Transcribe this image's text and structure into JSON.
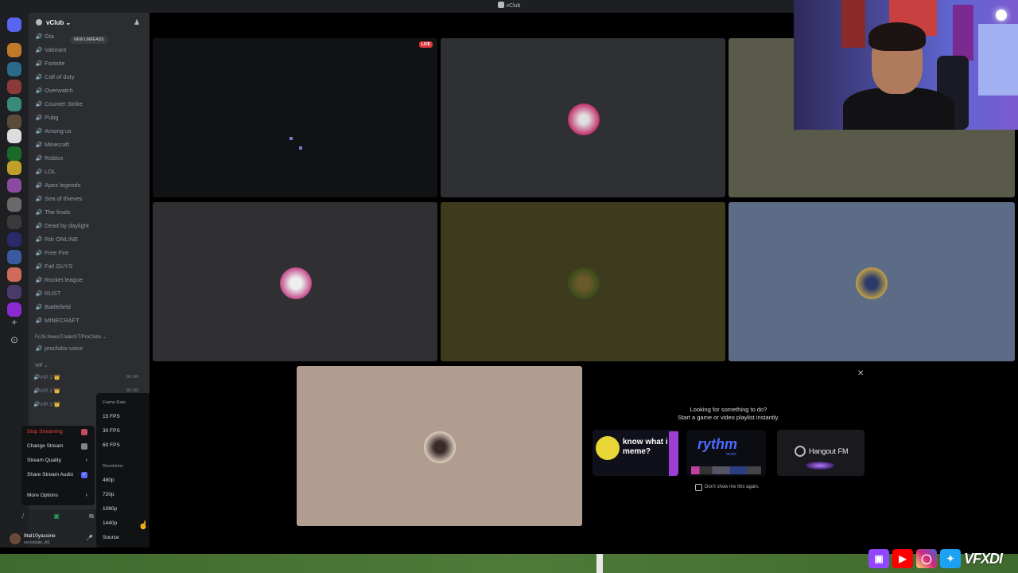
{
  "window": {
    "title": "vClub"
  },
  "server": {
    "name": "vClub ⌄",
    "new_unreads": "NEW UNREADS"
  },
  "channels": [
    "Gta",
    "Valorant",
    "Fortnite",
    "Call of duty",
    "Overwatch",
    "Counter Strike",
    "Pubg",
    "Among us",
    "Minecraft",
    "Roblox",
    "LOL",
    "Apex legends",
    "Sea of thieves",
    "The finals",
    "Dead by daylight",
    "Rdr ONLINE",
    "Free Fire",
    "Fall GUYS",
    "Rocket league",
    "RUST",
    "Battlefield",
    "MINECRAFT"
  ],
  "categories": {
    "fc26": "Fc26-News/Trade/UT/ProClubs ⌄",
    "proclubs_voice": "proclubs-voice",
    "vip": "VIP ⌄"
  },
  "vip_channels": [
    {
      "label": "VIP 1 👑",
      "count": "00 / 99"
    },
    {
      "label": "VIP 2 👑",
      "count": "00 / 99"
    },
    {
      "label": "VIP 3 👑",
      "count": ""
    }
  ],
  "stream_menu": {
    "stop": "Stop Streaming",
    "change": "Change Stream",
    "quality": "Stream Quality",
    "audio": "Share Stream Audio",
    "more": "More Options"
  },
  "quality_menu": {
    "frame_rate_header": "Frame Rate",
    "frame_rates": [
      "15 FPS",
      "30 FPS",
      "60 FPS"
    ],
    "frame_rate_selected": "60 FPS",
    "resolution_header": "Resolution",
    "resolutions": [
      "480p",
      "720p",
      "1080p",
      "1440p",
      "Source"
    ],
    "resolution_selected": "1440p"
  },
  "user": {
    "name": "9tal10yassine",
    "status": "escorpiate_AS"
  },
  "stage": {
    "live_badge": "LIVE"
  },
  "activity": {
    "title": "Looking for something to do?",
    "subtitle": "Start a game or video playlist instantly.",
    "cards": {
      "kwim": "know what i meme?",
      "rythm": "rythm",
      "rythm_sub": "music",
      "hangout": "Hangout FM"
    },
    "dont_show": "Don't show me this again."
  },
  "socials": {
    "handle": "VFXDI",
    "icons": [
      "twitch-icon",
      "youtube-icon",
      "instagram-icon",
      "twitter-icon"
    ]
  },
  "colors": {
    "accent": "#5865f2",
    "live": "#da373c",
    "sidebar": "#2b2d31",
    "rail": "#1e1f22"
  }
}
